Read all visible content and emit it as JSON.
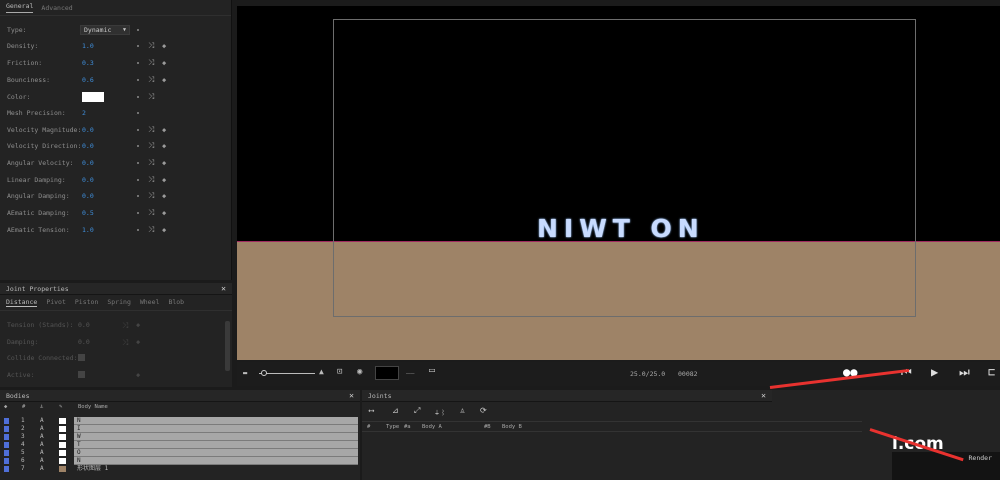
{
  "properties_panel": {
    "tabs": [
      "General",
      "Advanced"
    ],
    "type": {
      "label": "Type:",
      "value": "Dynamic"
    },
    "rows": [
      {
        "label": "Density:",
        "value": "1.0"
      },
      {
        "label": "Friction:",
        "value": "0.3"
      },
      {
        "label": "Bounciness:",
        "value": "0.6"
      }
    ],
    "color": {
      "label": "Color:",
      "value": "#ffffff"
    },
    "mesh_precision": {
      "label": "Mesh Precision:",
      "value": "2"
    },
    "rows2": [
      {
        "label": "Velocity Magnitude:",
        "value": "0.0"
      },
      {
        "label": "Velocity Direction:",
        "value": "0.0"
      },
      {
        "label": "Angular Velocity:",
        "value": "0.0"
      },
      {
        "label": "Linear Damping:",
        "value": "0.0"
      },
      {
        "label": "Angular Damping:",
        "value": "0.0"
      },
      {
        "label": "AEmatic Damping:",
        "value": "0.5"
      },
      {
        "label": "AEmatic Tension:",
        "value": "1.0"
      }
    ]
  },
  "joint_properties": {
    "title": "Joint Properties",
    "tabs": [
      "Distance",
      "Pivot",
      "Piston",
      "Spring",
      "Wheel",
      "Blob"
    ],
    "rows": [
      {
        "label": "Tension (Stands):",
        "value": "0.0"
      },
      {
        "label": "Damping:",
        "value": "0.0"
      },
      {
        "label": "Collide Connected:",
        "value": ""
      },
      {
        "label": "Active:",
        "value": ""
      }
    ]
  },
  "viewport": {
    "text": "NIWT ON",
    "colors": {
      "ground": "#9e8367",
      "background": "#000000"
    }
  },
  "timeline": {
    "time": "25.0/25.0",
    "frame": "00082",
    "separator": "__"
  },
  "bodies_panel": {
    "title": "Bodies",
    "col_header": "Body Name",
    "col_num": "#",
    "rows": [
      {
        "num": "1",
        "a": "A",
        "name": "N"
      },
      {
        "num": "2",
        "a": "A",
        "name": "I"
      },
      {
        "num": "3",
        "a": "A",
        "name": "W"
      },
      {
        "num": "4",
        "a": "A",
        "name": "T"
      },
      {
        "num": "5",
        "a": "A",
        "name": "O"
      },
      {
        "num": "6",
        "a": "A",
        "name": "N"
      },
      {
        "num": "7",
        "a": "A",
        "name": "形状图层 1"
      }
    ]
  },
  "joints_panel": {
    "title": "Joints",
    "columns": [
      "#",
      "Type",
      "#a",
      "Body A",
      "#B",
      "Body B"
    ],
    "render_label": "Render",
    "watermark": "l.com"
  }
}
